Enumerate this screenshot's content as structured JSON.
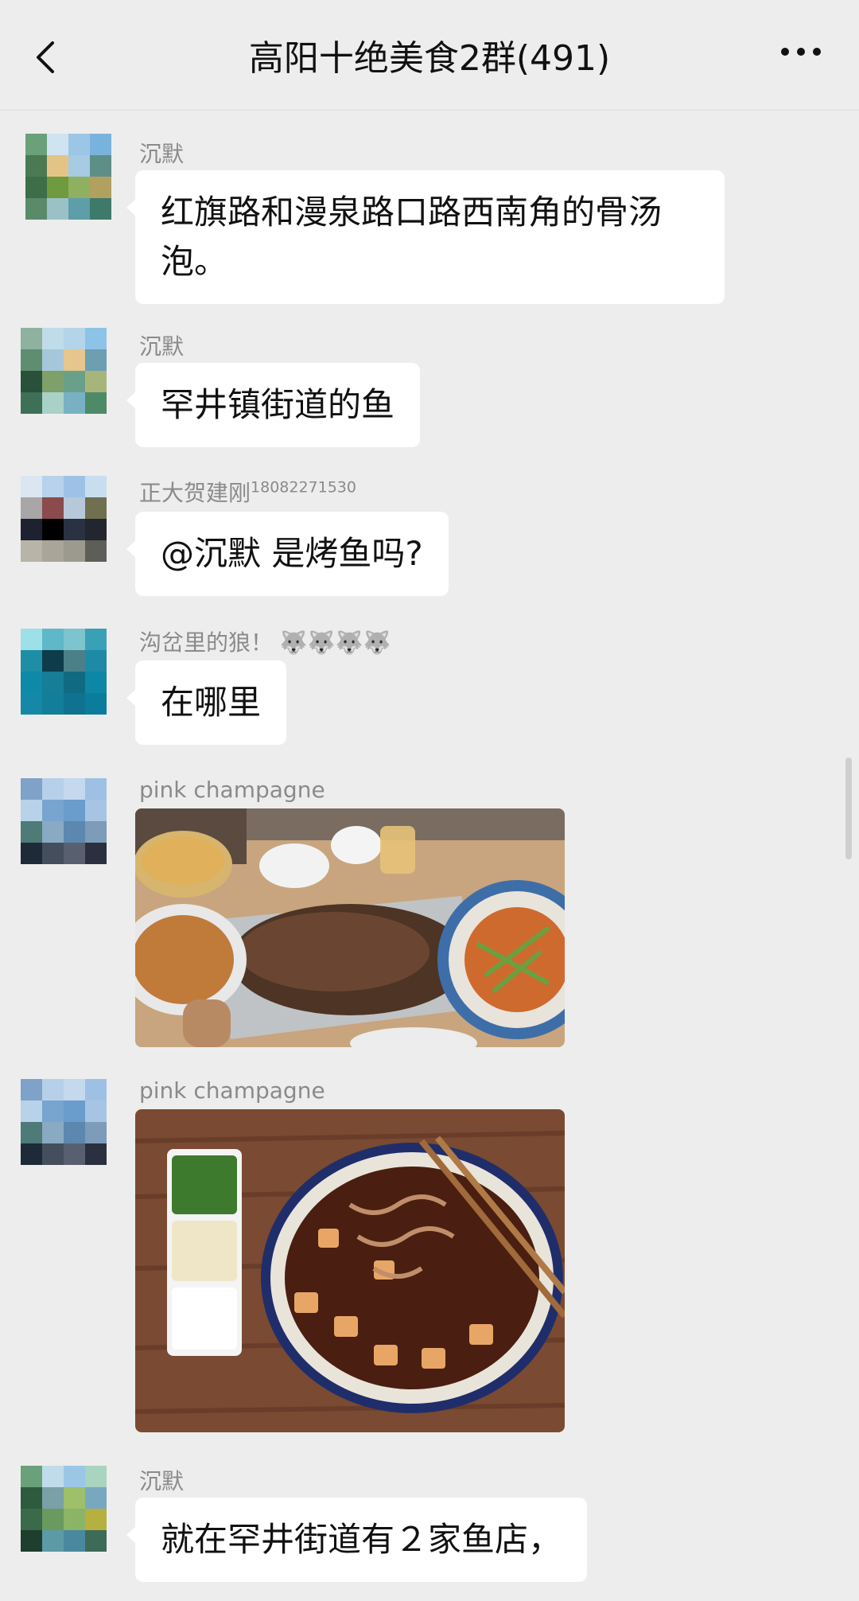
{
  "header": {
    "title": "高阳十绝美食2群(491)",
    "back_icon": "chevron-left-icon",
    "more_icon": "more-dots-icon"
  },
  "messages": [
    {
      "sender": "沉默",
      "text": "红旗路和漫泉路口路西南角的骨汤泡。"
    },
    {
      "sender": "沉默",
      "text": "罕井镇街道的鱼"
    },
    {
      "sender": "正大贺建刚",
      "sender_suffix": "18082271530",
      "text": "@沉默  是烤鱼吗?"
    },
    {
      "sender": "沟岔里的狼！ 🐺🐺🐺🐺",
      "text": "在哪里"
    },
    {
      "sender": "pink champagne",
      "image": "grilled-fish-dinner-photo"
    },
    {
      "sender": "pink champagne",
      "image": "spicy-stew-dinner-photo"
    },
    {
      "sender": "沉默",
      "text": "就在罕井街道有２家鱼店，"
    }
  ],
  "colors": {
    "background": "#ededed",
    "bubble": "#ffffff",
    "sender_name": "#8a8a8a"
  }
}
